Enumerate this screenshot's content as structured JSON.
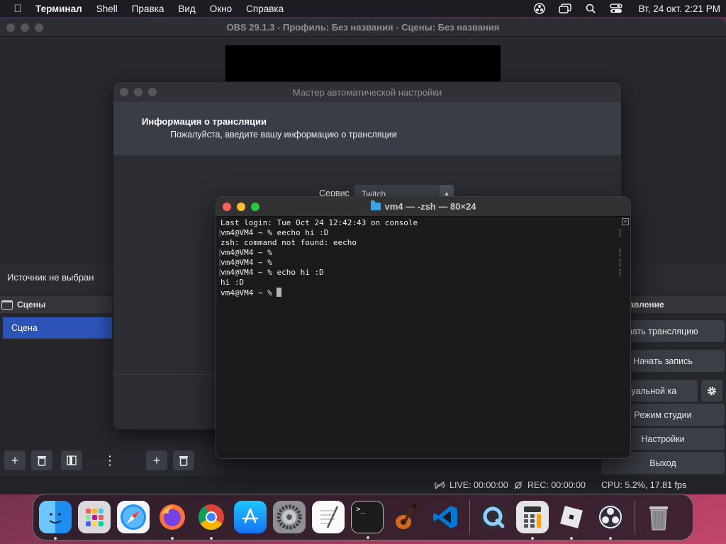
{
  "menubar": {
    "app_name": "Терминал",
    "items": [
      "Shell",
      "Правка",
      "Вид",
      "Окно",
      "Справка"
    ],
    "clock": "Вт, 24 окт.  2:21 PM"
  },
  "obs": {
    "title": "OBS 29.1.3 - Профиль: Без названия - Сцены: Без названия",
    "source_status": "Источник не выбран",
    "scenes_header": "Сцены",
    "scenes": [
      "Сцена"
    ],
    "controls_header": "равление",
    "controls": {
      "start_stream": "чать трансляцию",
      "start_record": "Начать запись",
      "virtual_cam": "отуальной ка",
      "studio_mode": "Режим студии",
      "settings": "Настройки",
      "exit": "Выход"
    },
    "status": {
      "live": "LIVE: 00:00:00",
      "rec": "REC: 00:00:00",
      "cpu": "CPU: 5.2%, 17.81 fps"
    }
  },
  "wizard": {
    "title": "Мастер автоматической настройки",
    "heading": "Информация о трансляции",
    "subheading": "Пожалуйста, введите вашу информацию о трансляции",
    "service_label": "Сервис",
    "service_value": "Twitch"
  },
  "terminal": {
    "title": "vm4 — -zsh — 80×24",
    "lines": [
      "Last login: Tue Oct 24 12:42:43 on console",
      "vm4@VM4 ~ % eecho hi :D",
      "zsh: command not found: eecho",
      "vm4@VM4 ~ %",
      "vm4@VM4 ~ %",
      "vm4@VM4 ~ % echo hi :D",
      "hi :D",
      "vm4@VM4 ~ % "
    ]
  },
  "dock": {
    "apps": [
      "finder-icon",
      "launchpad-icon",
      "safari-icon",
      "firefox-icon",
      "chrome-icon",
      "app-store-icon",
      "system-settings-icon",
      "textedit-icon",
      "terminal-icon",
      "garageband-icon",
      "vscode-icon",
      "quicktime-icon",
      "calculator-icon",
      "roblox-icon",
      "obs-icon",
      "trash-icon"
    ]
  },
  "colors": {
    "accent_blue": "#2c54b8",
    "traffic_red": "#ff5f57",
    "traffic_yellow": "#febc2e",
    "traffic_green": "#28c840"
  }
}
